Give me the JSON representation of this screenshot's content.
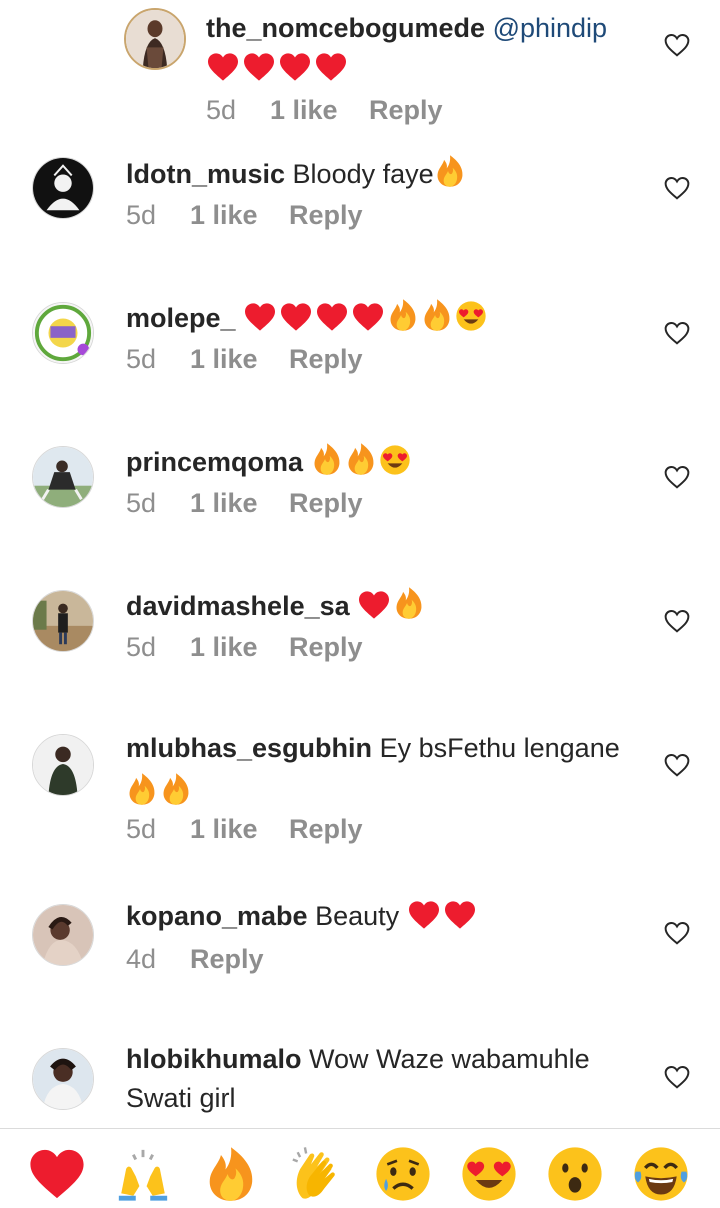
{
  "comments": [
    {
      "username": "the_nomcebogumede",
      "mention": "@phindip",
      "text": "",
      "emojis": [
        "red-heart",
        "red-heart",
        "red-heart",
        "red-heart"
      ],
      "time": "5d",
      "likes": "1 like",
      "reply": "Reply"
    },
    {
      "username": "ldotn_music",
      "text": "Bloody faye",
      "emojis": [
        "fire"
      ],
      "time": "5d",
      "likes": "1 like",
      "reply": "Reply"
    },
    {
      "username": "molepe_",
      "text": "",
      "emojis": [
        "red-heart",
        "red-heart",
        "red-heart",
        "red-heart",
        "fire",
        "fire",
        "heart-eyes"
      ],
      "time": "5d",
      "likes": "1 like",
      "reply": "Reply"
    },
    {
      "username": "princemqoma",
      "text": "",
      "emojis": [
        "fire",
        "fire",
        "heart-eyes"
      ],
      "time": "5d",
      "likes": "1 like",
      "reply": "Reply"
    },
    {
      "username": "davidmashele_sa",
      "text": "",
      "emojis": [
        "red-heart",
        "fire"
      ],
      "time": "5d",
      "likes": "1 like",
      "reply": "Reply"
    },
    {
      "username": "mlubhas_esgubhin",
      "text": "Ey bsFethu lengane",
      "emojis": [
        "fire",
        "fire"
      ],
      "time": "5d",
      "likes": "1 like",
      "reply": "Reply"
    },
    {
      "username": "kopano_mabe",
      "text": "Beauty",
      "emojis": [
        "red-heart",
        "red-heart"
      ],
      "time": "4d",
      "likes": "",
      "reply": "Reply"
    },
    {
      "username": "hlobikhumalo",
      "text": "Wow Waze wabamuhle",
      "text_line2": "Swati girl",
      "emojis": [],
      "time": "",
      "likes": "",
      "reply": ""
    }
  ],
  "quick_reactions": [
    "red-heart",
    "raising-hands",
    "fire",
    "clapping-hands",
    "sad-face",
    "heart-eyes",
    "surprised-face",
    "tears-of-joy"
  ],
  "colors": {
    "username": "#262626",
    "mention": "#1f4a78",
    "meta": "#8e8e8e",
    "heart": "#ed1c2e",
    "fire": "#f7941d",
    "emoji_face": "#fcc21b"
  }
}
